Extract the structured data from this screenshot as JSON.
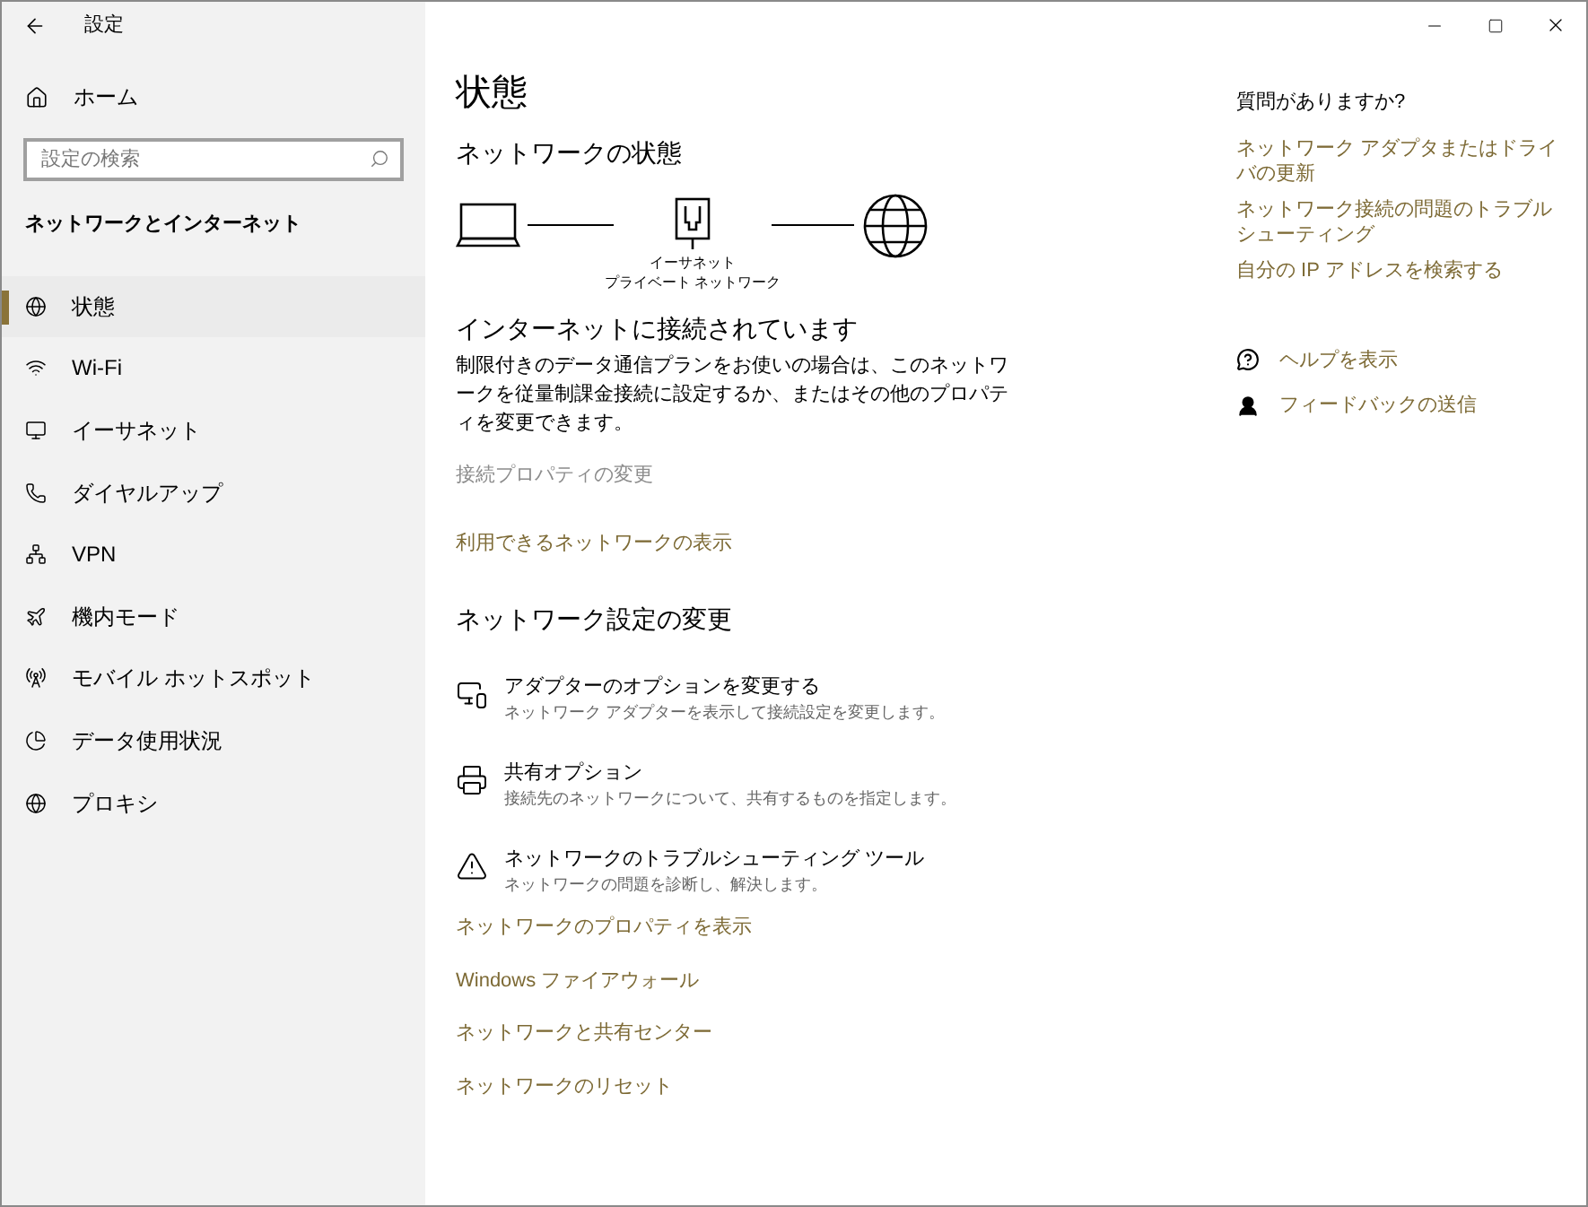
{
  "window": {
    "title": "設定"
  },
  "sidebar": {
    "home": "ホーム",
    "search": {
      "placeholder": "設定の検索"
    },
    "section_title": "ネットワークとインターネット",
    "items": [
      {
        "label": "状態",
        "selected": true
      },
      {
        "label": "Wi-Fi",
        "selected": false
      },
      {
        "label": "イーサネット",
        "selected": false
      },
      {
        "label": "ダイヤルアップ",
        "selected": false
      },
      {
        "label": "VPN",
        "selected": false
      },
      {
        "label": "機内モード",
        "selected": false
      },
      {
        "label": "モバイル ホットスポット",
        "selected": false
      },
      {
        "label": "データ使用状況",
        "selected": false
      },
      {
        "label": "プロキシ",
        "selected": false
      }
    ]
  },
  "main": {
    "title": "状態",
    "network_status": {
      "heading": "ネットワークの状態",
      "connection_name": "イーサネット",
      "network_type": "プライベート ネットワーク",
      "status": "インターネットに接続されています",
      "description": "制限付きのデータ通信プランをお使いの場合は、このネットワークを従量制課金接続に設定するか、またはその他のプロパティを変更できます。",
      "links": [
        {
          "label": "接続プロパティの変更",
          "disabled": true
        },
        {
          "label": "利用できるネットワークの表示",
          "disabled": false
        }
      ]
    },
    "change_settings": {
      "heading": "ネットワーク設定の変更",
      "options": [
        {
          "title": "アダプターのオプションを変更する",
          "description": "ネットワーク アダプターを表示して接続設定を変更します。"
        },
        {
          "title": "共有オプション",
          "description": "接続先のネットワークについて、共有するものを指定します。"
        },
        {
          "title": "ネットワークのトラブルシューティング ツール",
          "description": "ネットワークの問題を診断し、解決します。"
        }
      ],
      "links": [
        "ネットワークのプロパティを表示",
        "Windows ファイアウォール",
        "ネットワークと共有センター",
        "ネットワークのリセット"
      ]
    }
  },
  "aside": {
    "heading": "質問がありますか?",
    "links": [
      "ネットワーク アダプタまたはドライバの更新",
      "ネットワーク接続の問題のトラブルシューティング",
      "自分の IP アドレスを検索する"
    ],
    "help": [
      "ヘルプを表示",
      "フィードバックの送信"
    ]
  }
}
